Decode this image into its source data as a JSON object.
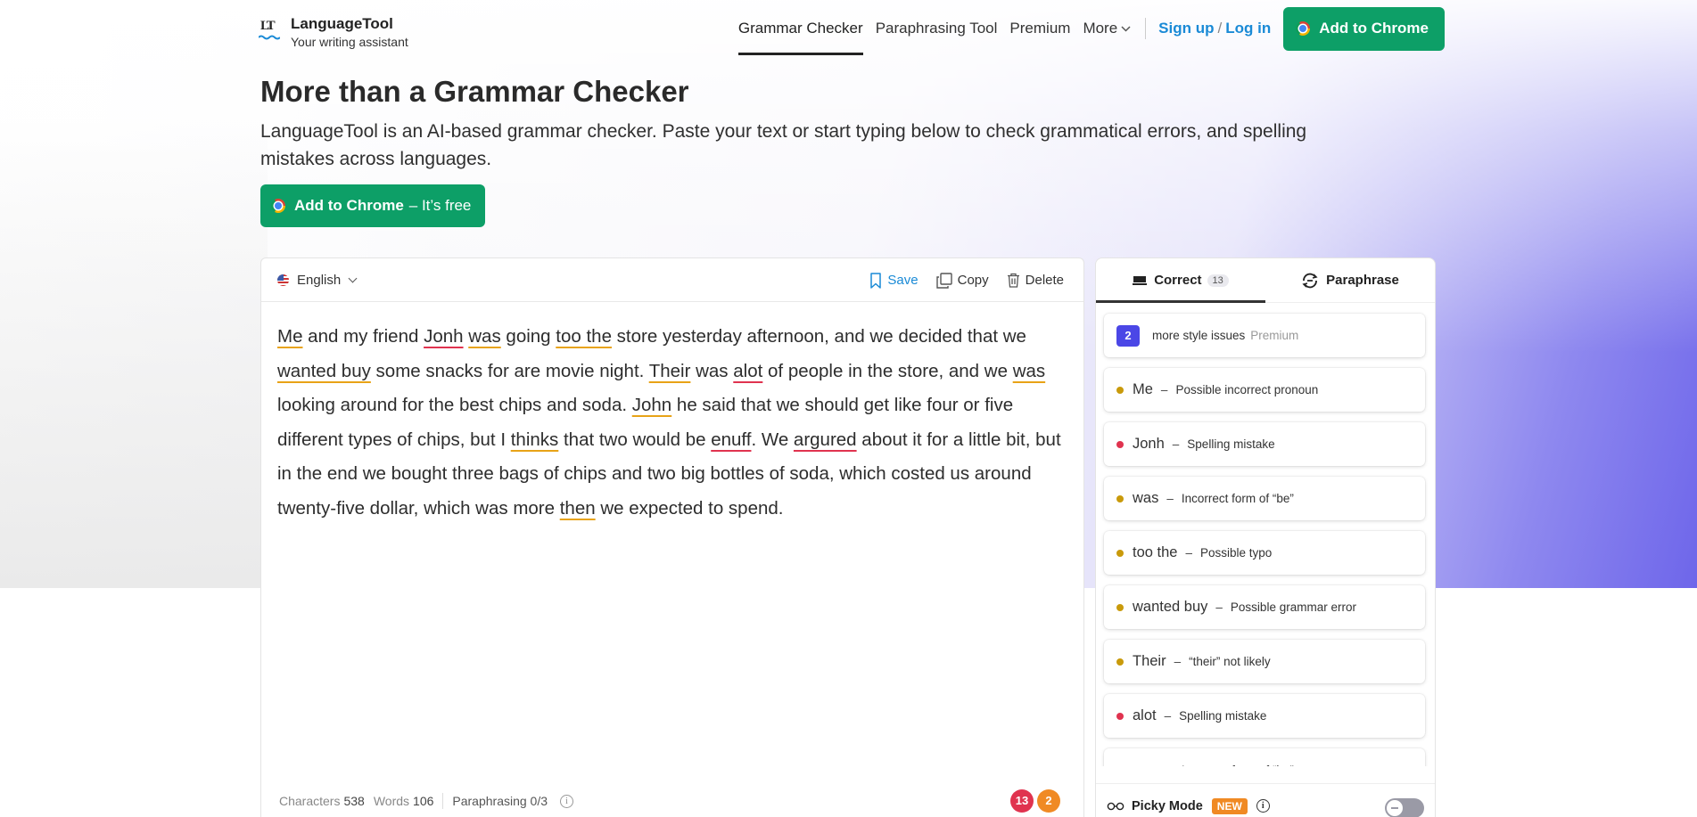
{
  "header": {
    "logo_name": "LanguageTool",
    "logo_tagline": "Your writing assistant",
    "nav": [
      {
        "label": "Grammar Checker",
        "active": true
      },
      {
        "label": "Paraphrasing Tool",
        "active": false
      },
      {
        "label": "Premium",
        "active": false
      }
    ],
    "more_label": "More",
    "signup_label": "Sign up",
    "auth_separator": "/",
    "login_label": "Log in",
    "add_chrome_label": "Add to Chrome"
  },
  "hero": {
    "title": "More than a Grammar Checker",
    "description": "LanguageTool is an AI-based grammar checker. Paste your text or start typing below to check grammatical errors, and spelling mistakes across languages.",
    "cta_bold": "Add to Chrome",
    "cta_rest": "– It’s free"
  },
  "editor": {
    "language": "English",
    "save_label": "Save",
    "copy_label": "Copy",
    "delete_label": "Delete",
    "text_segments": [
      {
        "t": "Me",
        "u": "y"
      },
      {
        "t": " and my friend "
      },
      {
        "t": "Jonh",
        "u": "r"
      },
      {
        "t": " "
      },
      {
        "t": "was",
        "u": "y"
      },
      {
        "t": " going "
      },
      {
        "t": "too the",
        "u": "y"
      },
      {
        "t": " store yesterday afternoon, and we decided that we "
      },
      {
        "t": "wanted buy",
        "u": "y"
      },
      {
        "t": " some snacks for are movie night. "
      },
      {
        "t": "Their",
        "u": "y"
      },
      {
        "t": " was "
      },
      {
        "t": "alot",
        "u": "r"
      },
      {
        "t": " of people in the store, and we "
      },
      {
        "t": "was",
        "u": "y"
      },
      {
        "t": " looking around for the best chips and soda. "
      },
      {
        "t": "John",
        "u": "y"
      },
      {
        "t": " he said that we should get like four or five different types of chips, but I "
      },
      {
        "t": "thinks",
        "u": "y"
      },
      {
        "t": " that two would be "
      },
      {
        "t": "enuff",
        "u": "r"
      },
      {
        "t": ". We "
      },
      {
        "t": "argured",
        "u": "r"
      },
      {
        "t": " about it for a little bit, but in the end we bought three bags of chips and two big bottles of soda, which costed us around twenty-five dollar, which was more "
      },
      {
        "t": "then",
        "u": "y"
      },
      {
        "t": " we expected to spend."
      }
    ],
    "footer": {
      "characters_label": "Characters",
      "characters_value": "538",
      "words_label": "Words",
      "words_value": "106",
      "paraphrasing_label": "Paraphrasing 0/3",
      "error_count": "13",
      "style_count": "2"
    }
  },
  "panel": {
    "tab_correct": "Correct",
    "tab_correct_count": "13",
    "tab_paraphrase": "Paraphrase",
    "premium_card": {
      "count": "2",
      "text": "more style issues",
      "tag": "Premium"
    },
    "issues": [
      {
        "word": "Me",
        "desc": "Possible incorrect pronoun",
        "severity": "y"
      },
      {
        "word": "Jonh",
        "desc": "Spelling mistake",
        "severity": "r"
      },
      {
        "word": "was",
        "desc": "Incorrect form of “be”",
        "severity": "y"
      },
      {
        "word": "too the",
        "desc": "Possible typo",
        "severity": "y"
      },
      {
        "word": "wanted buy",
        "desc": "Possible grammar error",
        "severity": "y"
      },
      {
        "word": "Their",
        "desc": "“their” not likely",
        "severity": "y"
      },
      {
        "word": "alot",
        "desc": "Spelling mistake",
        "severity": "r"
      },
      {
        "word": "was",
        "desc": "Incorrect form of “be”",
        "severity": "y"
      }
    ],
    "picky_label": "Picky Mode",
    "picky_badge": "NEW",
    "colors": {
      "yellow": "#c99a0b",
      "red": "#e0334f",
      "green": "#0d9f67",
      "accent": "#4b47e6"
    }
  }
}
